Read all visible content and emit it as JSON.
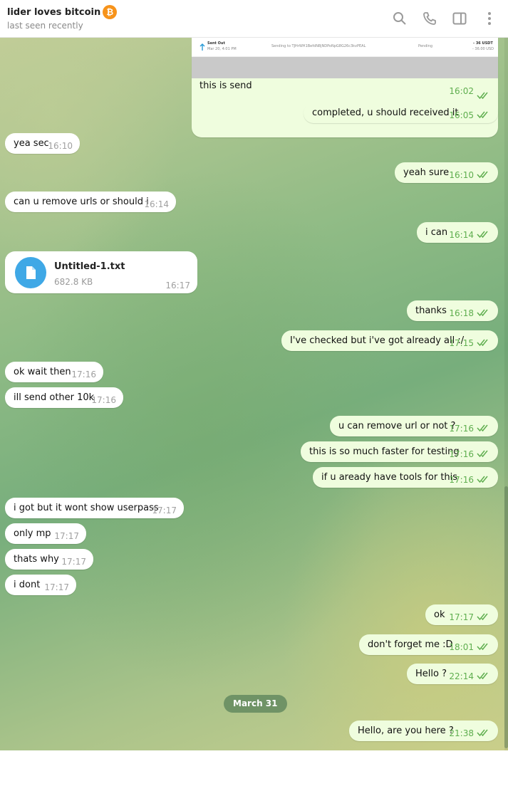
{
  "header": {
    "title": "lider loves bitcoin",
    "badge": "₿",
    "status": "last seen recently"
  },
  "preview": {
    "row_label": "Sent Out",
    "row_date": "Mar 20, 4:01 PM",
    "row_desc": "Sending to TJHrWH1BefdN8jNDPoNpG8G26c3kvPEAL",
    "row_status": "Pending",
    "row_amount": "- 36 USDT",
    "row_amount_usd": "- 36.00 USD",
    "caption": "this is send",
    "time": "16:02"
  },
  "file": {
    "name": "Untitled-1.txt",
    "size": "682.8 KB",
    "time": "16:17"
  },
  "date_separator": "March 31",
  "messages": [
    {
      "dir": "out",
      "text": "completed, u should received it",
      "time": "16:05"
    },
    {
      "dir": "in",
      "text": "yea sec",
      "time": "16:10"
    },
    {
      "dir": "out",
      "text": "yeah sure",
      "time": "16:10"
    },
    {
      "dir": "in",
      "text": "can  u remove urls or should i",
      "time": "16:14"
    },
    {
      "dir": "out",
      "text": "i can",
      "time": "16:14"
    },
    {
      "dir": "out",
      "text": "thanks",
      "time": "16:18"
    },
    {
      "dir": "out",
      "text": "I've checked but i've got already all :/",
      "time": "17:15"
    },
    {
      "dir": "in",
      "text": "ok wait then",
      "time": "17:16"
    },
    {
      "dir": "in",
      "text": "ill send other 10k",
      "time": "17:16"
    },
    {
      "dir": "out",
      "text": "u can remove url or not ?",
      "time": "17:16"
    },
    {
      "dir": "out",
      "text": "this is so much faster for testing",
      "time": "17:16"
    },
    {
      "dir": "out",
      "text": "if u aready have tools for this",
      "time": "17:16"
    },
    {
      "dir": "in",
      "text": "i got but it wont show userpass",
      "time": "17:17"
    },
    {
      "dir": "in",
      "text": "only mp",
      "time": "17:17"
    },
    {
      "dir": "in",
      "text": "thats why",
      "time": "17:17"
    },
    {
      "dir": "in",
      "text": "i dont",
      "time": "17:17"
    },
    {
      "dir": "out",
      "text": "ok",
      "time": "17:17"
    },
    {
      "dir": "out",
      "text": "don't forget me :D",
      "time": "18:01"
    },
    {
      "dir": "out",
      "text": "Hello ?",
      "time": "22:14"
    },
    {
      "dir": "out",
      "text": "Hello, are you here ?",
      "time": "21:38"
    }
  ]
}
